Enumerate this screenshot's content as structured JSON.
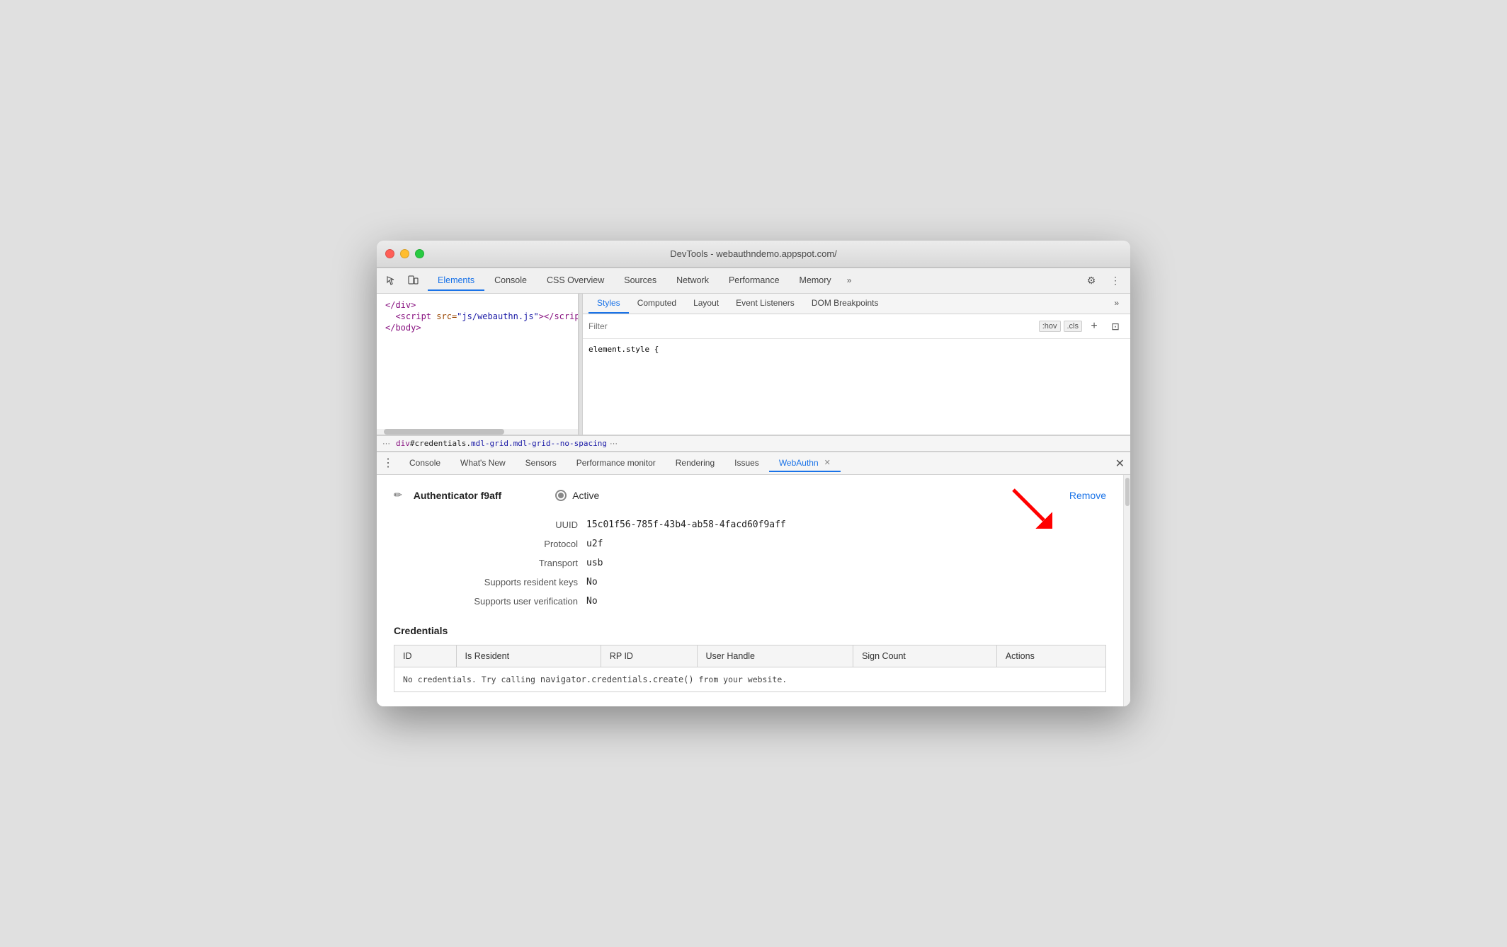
{
  "window": {
    "title": "DevTools - webauthndemo.appspot.com/"
  },
  "traffic_lights": {
    "red": "close",
    "yellow": "minimize",
    "green": "maximize"
  },
  "top_toolbar": {
    "inspect_icon": "⬚",
    "device_icon": "📱",
    "tabs": [
      {
        "id": "elements",
        "label": "Elements",
        "active": true
      },
      {
        "id": "console",
        "label": "Console",
        "active": false
      },
      {
        "id": "css-overview",
        "label": "CSS Overview",
        "active": false
      },
      {
        "id": "sources",
        "label": "Sources",
        "active": false
      },
      {
        "id": "network",
        "label": "Network",
        "active": false
      },
      {
        "id": "performance",
        "label": "Performance",
        "active": false
      },
      {
        "id": "memory",
        "label": "Memory",
        "active": false
      }
    ],
    "more_label": "»",
    "settings_icon": "⚙",
    "menu_icon": "⋮"
  },
  "dom_pane": {
    "lines": [
      {
        "text": "</div>",
        "type": "tag"
      },
      {
        "html": "<span class='dom-tag'>&lt;script</span> <span class='dom-attr-name'>src=</span><span class='dom-attr-value'>\"js/webauthn.js\"</span><span class='dom-tag'>&gt;&lt;/script&gt;</span>"
      },
      {
        "text": "</body>",
        "type": "tag"
      }
    ]
  },
  "breadcrumb": {
    "dots": "···",
    "path": "div#credentials.mdl-grid.mdl-grid--no-spacing",
    "more": "···"
  },
  "styles_pane": {
    "tabs": [
      {
        "id": "styles",
        "label": "Styles",
        "active": true
      },
      {
        "id": "computed",
        "label": "Computed",
        "active": false
      },
      {
        "id": "layout",
        "label": "Layout",
        "active": false
      },
      {
        "id": "event-listeners",
        "label": "Event Listeners",
        "active": false
      },
      {
        "id": "dom-breakpoints",
        "label": "DOM Breakpoints",
        "active": false
      }
    ],
    "more_label": "»",
    "filter": {
      "placeholder": "Filter",
      "hov_btn": ":hov",
      "cls_btn": ".cls",
      "plus_btn": "+",
      "layout_btn": "⊡"
    },
    "content": "element.style {"
  },
  "drawer": {
    "tabs": [
      {
        "id": "console",
        "label": "Console",
        "active": false,
        "closable": false
      },
      {
        "id": "whats-new",
        "label": "What's New",
        "active": false,
        "closable": false
      },
      {
        "id": "sensors",
        "label": "Sensors",
        "active": false,
        "closable": false
      },
      {
        "id": "performance-monitor",
        "label": "Performance monitor",
        "active": false,
        "closable": false
      },
      {
        "id": "rendering",
        "label": "Rendering",
        "active": false,
        "closable": false
      },
      {
        "id": "issues",
        "label": "Issues",
        "active": false,
        "closable": false
      },
      {
        "id": "webauthn",
        "label": "WebAuthn",
        "active": true,
        "closable": true
      }
    ],
    "close_btn": "✕"
  },
  "webauthn": {
    "edit_icon": "✏",
    "authenticator_name": "Authenticator f9aff",
    "active_label": "Active",
    "remove_label": "Remove",
    "properties": [
      {
        "label": "UUID",
        "value": "15c01f56-785f-43b4-ab58-4facd60f9aff"
      },
      {
        "label": "Protocol",
        "value": "u2f"
      },
      {
        "label": "Transport",
        "value": "usb"
      },
      {
        "label": "Supports resident keys",
        "value": "No"
      },
      {
        "label": "Supports user verification",
        "value": "No"
      }
    ],
    "credentials_title": "Credentials",
    "credentials_columns": [
      "ID",
      "Is Resident",
      "RP ID",
      "User Handle",
      "Sign Count",
      "Actions"
    ],
    "credentials_empty": "No credentials. Try calling navigator.credentials.create() from your website."
  }
}
